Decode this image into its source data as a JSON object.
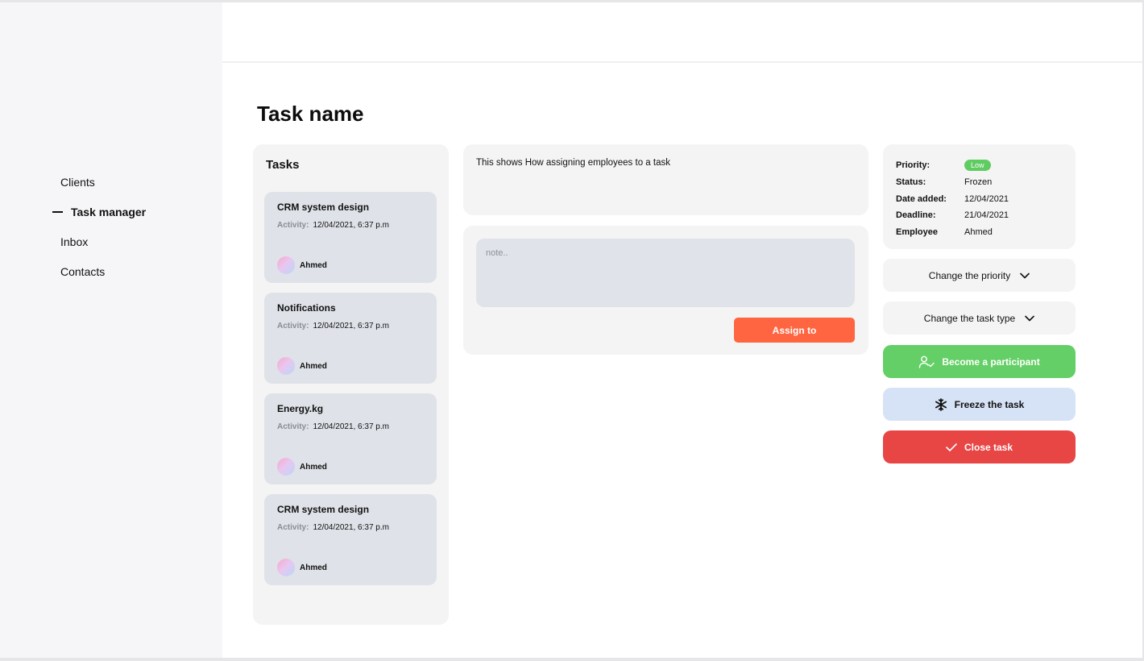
{
  "nav": {
    "items": [
      {
        "label": "Clients"
      },
      {
        "label": "Task manager"
      },
      {
        "label": "Inbox"
      },
      {
        "label": "Contacts"
      }
    ]
  },
  "page": {
    "title": "Task name"
  },
  "tasks": {
    "heading": "Tasks",
    "activity_label": "Activity:",
    "items": [
      {
        "title": "CRM system design",
        "activity": "12/04/2021, 6:37 p.m",
        "user": "Ahmed"
      },
      {
        "title": "Notifications",
        "activity": "12/04/2021, 6:37 p.m",
        "user": "Ahmed"
      },
      {
        "title": "Energy.kg",
        "activity": "12/04/2021, 6:37 p.m",
        "user": "Ahmed"
      },
      {
        "title": "CRM system design",
        "activity": "12/04/2021, 6:37 p.m",
        "user": "Ahmed"
      }
    ]
  },
  "description": {
    "text": "This shows How assigning employees to a task"
  },
  "note": {
    "placeholder": "note..",
    "assign_label": "Assign to"
  },
  "info": {
    "priority_label": "Priority:",
    "priority_value": "Low",
    "status_label": "Status:",
    "status_value": "Frozen",
    "date_added_label": "Date added:",
    "date_added_value": "12/04/2021",
    "deadline_label": "Deadline:",
    "deadline_value": "21/04/2021",
    "employee_label": "Employee",
    "employee_value": "Ahmed"
  },
  "actions": {
    "change_priority": "Change the priority",
    "change_type": "Change the task type",
    "become_participant": "Become a participant",
    "freeze": "Freeze the task",
    "close": "Close task"
  },
  "colors": {
    "accent_orange": "#fe6540",
    "green": "#64cf66",
    "red": "#e84545",
    "freeze_blue": "#d6e3f7",
    "badge_green": "#5fcc62"
  },
  "icons": {
    "active_marker": "dash-icon",
    "dropdown": "chevron-down-icon",
    "participant": "user-check-icon",
    "freeze": "snowflake-icon",
    "close": "check-icon"
  }
}
